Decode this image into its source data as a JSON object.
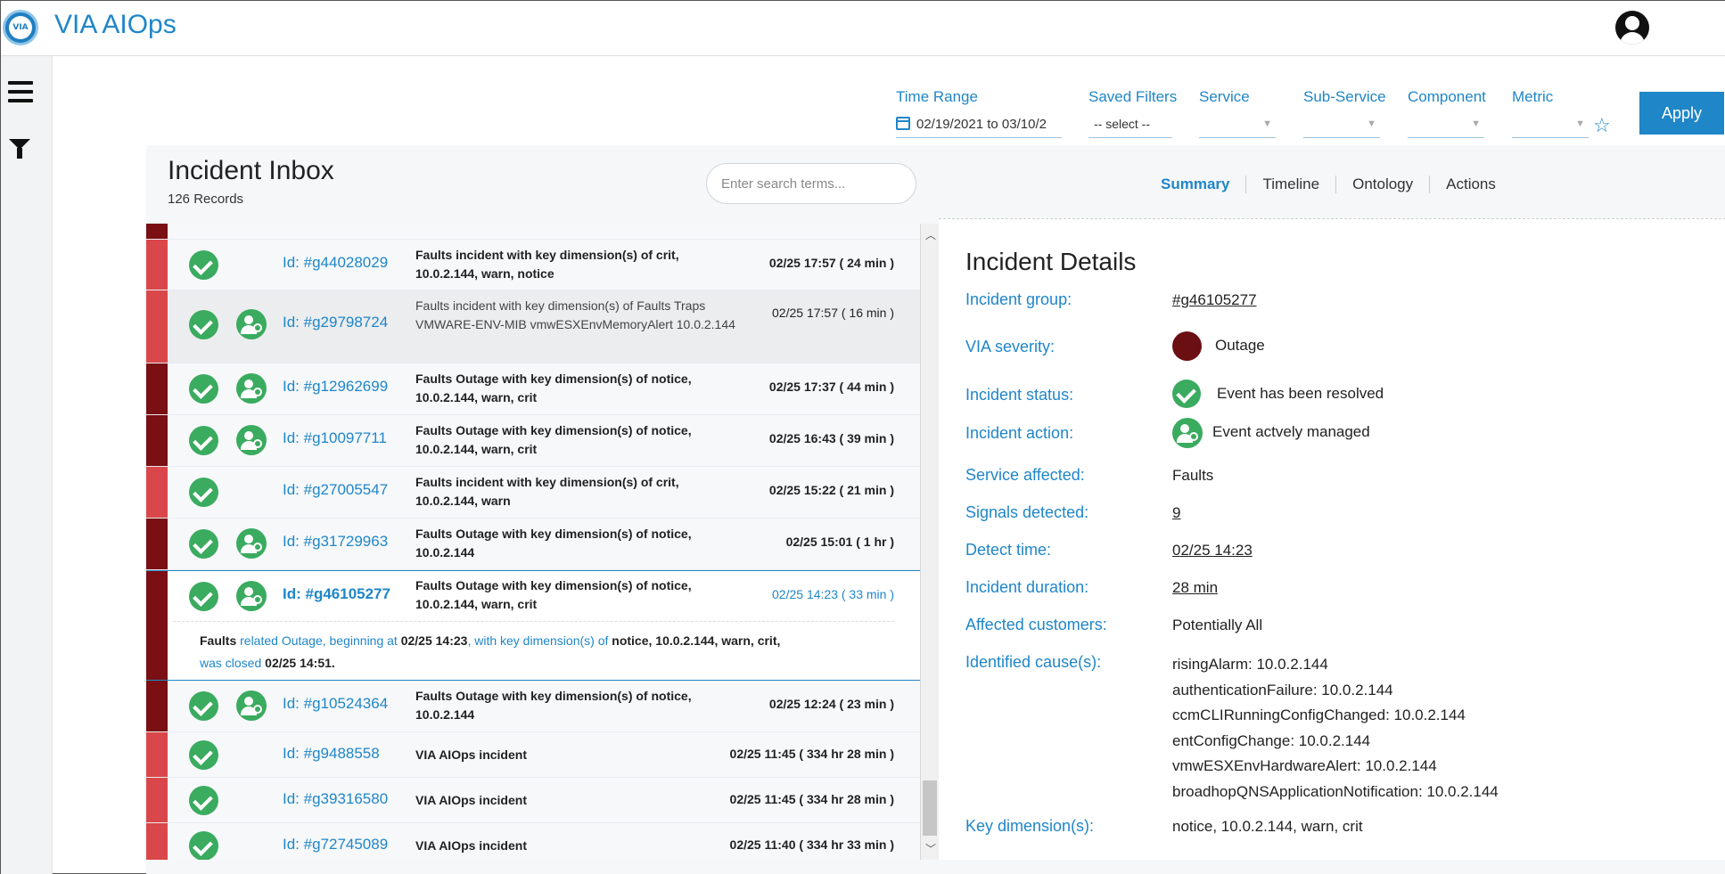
{
  "app": {
    "logo_text": "VIA",
    "title": "VIA AIOps"
  },
  "filters": {
    "time_range_label": "Time Range",
    "time_range_value": "02/19/2021 to 03/10/2",
    "saved_filters_label": "Saved Filters",
    "saved_filters_value": "-- select --",
    "service_label": "Service",
    "subservice_label": "Sub-Service",
    "component_label": "Component",
    "metric_label": "Metric",
    "apply_label": "Apply"
  },
  "inbox": {
    "title": "Incident Inbox",
    "count": "126 Records",
    "search_placeholder": "Enter search terms...",
    "tabs": [
      "Summary",
      "Timeline",
      "Ontology",
      "Actions"
    ]
  },
  "incidents": [
    {
      "id": "Id: #g44028029",
      "desc": "Faults incident with key dimension(s) of crit, 10.0.2.144, warn, notice",
      "time": "02/25 17:57 ( 24 min )",
      "severity": "red",
      "managed": false
    },
    {
      "id": "Id: #g29798724",
      "desc": "Faults incident with key dimension(s) of Faults Traps VMWARE-ENV-MIB vmwESXEnvMemoryAlert 10.0.2.144",
      "time": "02/25 17:57 ( 16 min )",
      "severity": "red",
      "managed": true
    },
    {
      "id": "Id: #g12962699",
      "desc": "Faults Outage with key dimension(s) of notice, 10.0.2.144, warn, crit",
      "time": "02/25 17:37 ( 44 min )",
      "severity": "dark",
      "managed": true
    },
    {
      "id": "Id: #g10097711",
      "desc": "Faults Outage with key dimension(s) of notice, 10.0.2.144, warn, crit",
      "time": "02/25 16:43 ( 39 min )",
      "severity": "dark",
      "managed": true
    },
    {
      "id": "Id: #g27005547",
      "desc": "Faults incident with key dimension(s) of crit, 10.0.2.144, warn",
      "time": "02/25 15:22 ( 21 min )",
      "severity": "red",
      "managed": false
    },
    {
      "id": "Id: #g31729963",
      "desc": "Faults Outage with key dimension(s) of notice, 10.0.2.144",
      "time": "02/25 15:01 ( 1 hr )",
      "severity": "dark",
      "managed": true
    },
    {
      "id": "Id: #g46105277",
      "desc": "Faults Outage with key dimension(s) of notice, 10.0.2.144, warn, crit",
      "time": "02/25 14:23 ( 33 min )",
      "severity": "dark",
      "managed": true
    },
    {
      "id": "Id: #g10524364",
      "desc": "Faults Outage with key dimension(s) of notice, 10.0.2.144",
      "time": "02/25 12:24 ( 23 min )",
      "severity": "dark",
      "managed": true
    },
    {
      "id": "Id: #g9488558",
      "desc": "VIA AIOps incident",
      "time": "02/25 11:45 ( 334 hr 28 min )",
      "severity": "red",
      "managed": false
    },
    {
      "id": "Id: #g39316580",
      "desc": "VIA AIOps incident",
      "time": "02/25 11:45 ( 334 hr 28 min )",
      "severity": "red",
      "managed": false
    },
    {
      "id": "Id: #g72745089",
      "desc": "VIA AIOps incident",
      "time": "02/25 11:40 ( 334 hr 33 min )",
      "severity": "red",
      "managed": false
    }
  ],
  "expanded": {
    "p1": "Faults",
    "p2": " related Outage, beginning at ",
    "p3": "02/25 14:23",
    "p4": ", with key dimension(s) of ",
    "p5": "notice, 10.0.2.144, warn, crit,",
    "p6": "was closed",
    "p7": " 02/25 14:51."
  },
  "details": {
    "title": "Incident Details",
    "labels": {
      "group": "Incident group:",
      "severity": "VIA severity:",
      "status": "Incident status:",
      "action": "Incident action:",
      "service": "Service affected:",
      "signals": "Signals detected:",
      "detect": "Detect time:",
      "duration": "Incident duration:",
      "customers": "Affected customers:",
      "causes": "Identified cause(s):",
      "keydim": "Key dimension(s):"
    },
    "values": {
      "group": "#g46105277",
      "severity": "Outage",
      "status": "Event has been resolved",
      "action": "Event actvely managed",
      "service": "Faults",
      "signals": "9",
      "detect": "02/25 14:23",
      "duration": "28 min",
      "customers": "Potentially All",
      "keydim": "notice, 10.0.2.144, warn, crit"
    },
    "causes": [
      "risingAlarm: 10.0.2.144",
      "authenticationFailure: 10.0.2.144",
      "ccmCLIRunningConfigChanged: 10.0.2.144",
      "entConfigChange: 10.0.2.144",
      "vmwESXEnvHardwareAlert: 10.0.2.144",
      "broadhopQNSApplicationNotification: 10.0.2.144"
    ]
  },
  "colors": {
    "accent": "#1f86c8",
    "severity_red": "#d9474a",
    "severity_dark": "#7a0f14",
    "resolved": "#3aab5f",
    "outage": "#6b0f12"
  },
  "icons": [
    "menu-icon",
    "filter-icon",
    "calendar-icon",
    "star-icon",
    "user-avatar-icon",
    "check-circle-icon",
    "managed-user-icon"
  ]
}
